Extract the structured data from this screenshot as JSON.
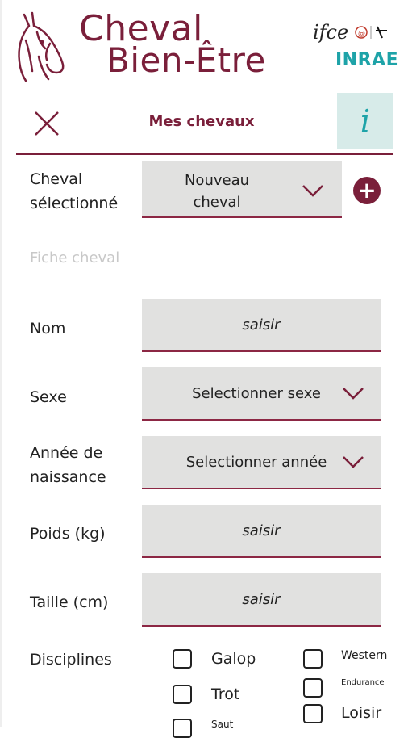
{
  "header": {
    "title_line1": "Cheval",
    "title_line2": "Bien-Être",
    "partner1": "ifce",
    "partner2": "INRAE"
  },
  "topbar": {
    "close_icon": "close-icon",
    "page_title": "Mes chevaux",
    "info_label": "i"
  },
  "form": {
    "cheval_label": "Cheval sélectionné",
    "cheval_value": "Nouveau cheval",
    "section_title": "Fiche cheval",
    "nom_label": "Nom",
    "nom_placeholder": "saisir",
    "sexe_label": "Sexe",
    "sexe_value": "Selectionner sexe",
    "annee_label": "Année de naissance",
    "annee_value": "Selectionner année",
    "poids_label": "Poids (kg)",
    "poids_placeholder": "saisir",
    "taille_label": "Taille (cm)",
    "taille_placeholder": "saisir",
    "disciplines_label": "Disciplines",
    "disciplines": [
      "Galop",
      "Trot",
      "Saut",
      "Western",
      "Endurance",
      "Loisir"
    ]
  },
  "colors": {
    "brand": "#7a1f3a",
    "teal": "#1ea3a8",
    "field_bg": "#e1e1e0"
  }
}
